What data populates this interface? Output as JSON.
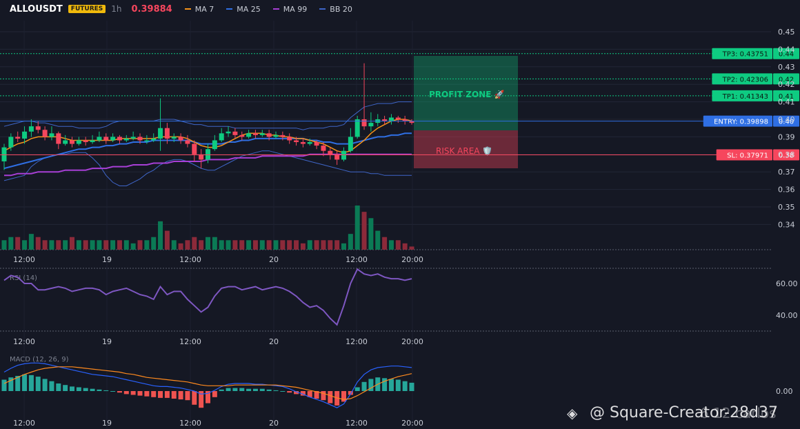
{
  "header": {
    "symbol": "ALLOUSDT",
    "badge": "FUTURES",
    "timeframe": "1h",
    "last_price": "0.39884",
    "legend": [
      {
        "label": "MA 7",
        "color": "#f7931a"
      },
      {
        "label": "MA 25",
        "color": "#2f6fe4"
      },
      {
        "label": "MA 99",
        "color": "#a83fd6"
      },
      {
        "label": "BB 20",
        "color": "#3f66c9"
      }
    ]
  },
  "colors": {
    "up": "#0ecb81",
    "down": "#f6465d",
    "background": "#151824"
  },
  "chart_data": {
    "type": "candlestick",
    "y_ticks": [
      "0.45",
      "0.44",
      "0.43",
      "0.42",
      "0.41",
      "0.40",
      "0.39",
      "0.38",
      "0.37",
      "0.36",
      "0.35",
      "0.34"
    ],
    "x_ticks": [
      "12:00",
      "19",
      "12:00",
      "20",
      "12:00",
      "20:00"
    ],
    "ylim": [
      0.335,
      0.452
    ],
    "candles": [
      [
        0.376,
        0.384,
        0.371,
        0.386
      ],
      [
        0.384,
        0.39,
        0.382,
        0.392
      ],
      [
        0.39,
        0.389,
        0.387,
        0.393
      ],
      [
        0.389,
        0.393,
        0.386,
        0.396
      ],
      [
        0.393,
        0.396,
        0.39,
        0.4
      ],
      [
        0.396,
        0.394,
        0.392,
        0.399
      ],
      [
        0.394,
        0.39,
        0.388,
        0.396
      ],
      [
        0.39,
        0.392,
        0.388,
        0.396
      ],
      [
        0.392,
        0.386,
        0.383,
        0.393
      ],
      [
        0.386,
        0.388,
        0.385,
        0.391
      ],
      [
        0.388,
        0.386,
        0.384,
        0.39
      ],
      [
        0.386,
        0.388,
        0.385,
        0.39
      ],
      [
        0.388,
        0.387,
        0.385,
        0.39
      ],
      [
        0.387,
        0.388,
        0.386,
        0.391
      ],
      [
        0.388,
        0.39,
        0.387,
        0.393
      ],
      [
        0.39,
        0.388,
        0.386,
        0.392
      ],
      [
        0.388,
        0.39,
        0.387,
        0.392
      ],
      [
        0.39,
        0.388,
        0.386,
        0.391
      ],
      [
        0.388,
        0.389,
        0.387,
        0.391
      ],
      [
        0.389,
        0.39,
        0.388,
        0.393
      ],
      [
        0.39,
        0.388,
        0.386,
        0.392
      ],
      [
        0.388,
        0.388,
        0.386,
        0.391
      ],
      [
        0.388,
        0.389,
        0.387,
        0.392
      ],
      [
        0.389,
        0.395,
        0.382,
        0.412
      ],
      [
        0.395,
        0.389,
        0.386,
        0.398
      ],
      [
        0.389,
        0.39,
        0.387,
        0.392
      ],
      [
        0.39,
        0.388,
        0.386,
        0.392
      ],
      [
        0.388,
        0.386,
        0.384,
        0.391
      ],
      [
        0.386,
        0.38,
        0.376,
        0.388
      ],
      [
        0.38,
        0.377,
        0.372,
        0.383
      ],
      [
        0.377,
        0.383,
        0.375,
        0.386
      ],
      [
        0.383,
        0.388,
        0.382,
        0.391
      ],
      [
        0.388,
        0.392,
        0.387,
        0.395
      ],
      [
        0.392,
        0.393,
        0.39,
        0.396
      ],
      [
        0.393,
        0.391,
        0.389,
        0.395
      ],
      [
        0.391,
        0.39,
        0.388,
        0.393
      ],
      [
        0.39,
        0.392,
        0.389,
        0.394
      ],
      [
        0.392,
        0.391,
        0.389,
        0.394
      ],
      [
        0.391,
        0.392,
        0.39,
        0.394
      ],
      [
        0.392,
        0.39,
        0.388,
        0.394
      ],
      [
        0.39,
        0.391,
        0.389,
        0.393
      ],
      [
        0.391,
        0.39,
        0.388,
        0.393
      ],
      [
        0.39,
        0.388,
        0.386,
        0.392
      ],
      [
        0.388,
        0.387,
        0.385,
        0.39
      ],
      [
        0.387,
        0.386,
        0.384,
        0.389
      ],
      [
        0.386,
        0.387,
        0.385,
        0.389
      ],
      [
        0.387,
        0.385,
        0.383,
        0.388
      ],
      [
        0.385,
        0.382,
        0.379,
        0.387
      ],
      [
        0.382,
        0.38,
        0.377,
        0.384
      ],
      [
        0.38,
        0.377,
        0.374,
        0.382
      ],
      [
        0.377,
        0.382,
        0.376,
        0.384
      ],
      [
        0.382,
        0.39,
        0.381,
        0.395
      ],
      [
        0.39,
        0.4,
        0.389,
        0.402
      ],
      [
        0.4,
        0.396,
        0.394,
        0.432
      ],
      [
        0.396,
        0.398,
        0.393,
        0.404
      ],
      [
        0.398,
        0.4,
        0.396,
        0.403
      ],
      [
        0.4,
        0.399,
        0.397,
        0.402
      ],
      [
        0.399,
        0.401,
        0.397,
        0.403
      ],
      [
        0.401,
        0.4,
        0.398,
        0.402
      ],
      [
        0.4,
        0.399,
        0.397,
        0.402
      ],
      [
        0.399,
        0.398,
        0.397,
        0.4
      ]
    ],
    "volume": [
      3,
      4,
      4,
      3,
      5,
      4,
      3,
      3,
      3,
      3,
      4,
      3,
      3,
      3,
      3,
      3,
      3,
      3,
      3,
      2,
      3,
      3,
      4,
      9,
      6,
      3,
      2,
      3,
      4,
      3,
      4,
      4,
      3,
      3,
      3,
      3,
      3,
      3,
      3,
      3,
      3,
      3,
      3,
      3,
      2,
      3,
      3,
      3,
      3,
      3,
      2,
      5,
      14,
      12,
      10,
      6,
      4,
      3,
      3,
      2,
      1
    ],
    "ma7": [
      0.382,
      0.384,
      0.386,
      0.387,
      0.389,
      0.39,
      0.39,
      0.39,
      0.39,
      0.389,
      0.388,
      0.388,
      0.388,
      0.388,
      0.388,
      0.388,
      0.388,
      0.389,
      0.389,
      0.389,
      0.389,
      0.389,
      0.389,
      0.39,
      0.39,
      0.39,
      0.39,
      0.389,
      0.387,
      0.385,
      0.384,
      0.384,
      0.385,
      0.387,
      0.389,
      0.391,
      0.392,
      0.392,
      0.392,
      0.391,
      0.391,
      0.39,
      0.39,
      0.389,
      0.389,
      0.388,
      0.387,
      0.386,
      0.384,
      0.382,
      0.381,
      0.382,
      0.385,
      0.388,
      0.392,
      0.395,
      0.397,
      0.399,
      0.4,
      0.4,
      0.399
    ],
    "ma25": [
      0.372,
      0.373,
      0.374,
      0.375,
      0.376,
      0.377,
      0.378,
      0.379,
      0.38,
      0.381,
      0.382,
      0.383,
      0.383,
      0.384,
      0.384,
      0.385,
      0.385,
      0.386,
      0.386,
      0.387,
      0.387,
      0.387,
      0.388,
      0.388,
      0.388,
      0.388,
      0.388,
      0.388,
      0.387,
      0.386,
      0.386,
      0.386,
      0.386,
      0.387,
      0.387,
      0.388,
      0.388,
      0.389,
      0.389,
      0.389,
      0.389,
      0.389,
      0.389,
      0.389,
      0.389,
      0.388,
      0.388,
      0.387,
      0.387,
      0.386,
      0.386,
      0.386,
      0.387,
      0.388,
      0.389,
      0.39,
      0.39,
      0.391,
      0.391,
      0.392,
      0.392
    ],
    "ma99": [
      0.368,
      0.368,
      0.369,
      0.369,
      0.369,
      0.37,
      0.37,
      0.37,
      0.37,
      0.371,
      0.371,
      0.371,
      0.371,
      0.372,
      0.372,
      0.372,
      0.373,
      0.373,
      0.373,
      0.374,
      0.374,
      0.374,
      0.375,
      0.375,
      0.375,
      0.376,
      0.376,
      0.376,
      0.376,
      0.376,
      0.377,
      0.377,
      0.377,
      0.377,
      0.378,
      0.378,
      0.378,
      0.378,
      0.379,
      0.379,
      0.379,
      0.379,
      0.379,
      0.379,
      0.379,
      0.38,
      0.38,
      0.38,
      0.38,
      0.38,
      0.38,
      0.38,
      0.38,
      0.38,
      0.38,
      0.38,
      0.38,
      0.38,
      0.38,
      0.38,
      0.38
    ],
    "bb_upper": [
      0.396,
      0.397,
      0.398,
      0.399,
      0.399,
      0.398,
      0.398,
      0.397,
      0.396,
      0.396,
      0.396,
      0.395,
      0.395,
      0.395,
      0.395,
      0.396,
      0.398,
      0.399,
      0.399,
      0.399,
      0.399,
      0.399,
      0.399,
      0.4,
      0.4,
      0.4,
      0.399,
      0.398,
      0.397,
      0.397,
      0.396,
      0.396,
      0.396,
      0.396,
      0.395,
      0.395,
      0.395,
      0.395,
      0.395,
      0.395,
      0.395,
      0.395,
      0.395,
      0.395,
      0.394,
      0.395,
      0.395,
      0.395,
      0.396,
      0.396,
      0.397,
      0.401,
      0.404,
      0.407,
      0.408,
      0.409,
      0.409,
      0.409,
      0.41,
      0.41,
      0.41
    ],
    "bb_lower": [
      0.365,
      0.366,
      0.367,
      0.368,
      0.373,
      0.376,
      0.378,
      0.379,
      0.38,
      0.38,
      0.381,
      0.381,
      0.381,
      0.378,
      0.374,
      0.368,
      0.364,
      0.362,
      0.362,
      0.364,
      0.366,
      0.369,
      0.371,
      0.374,
      0.376,
      0.377,
      0.377,
      0.376,
      0.374,
      0.372,
      0.371,
      0.371,
      0.373,
      0.375,
      0.377,
      0.379,
      0.38,
      0.381,
      0.382,
      0.382,
      0.381,
      0.38,
      0.379,
      0.378,
      0.377,
      0.376,
      0.375,
      0.374,
      0.373,
      0.372,
      0.371,
      0.37,
      0.37,
      0.37,
      0.369,
      0.369,
      0.368,
      0.368,
      0.368,
      0.368,
      0.368
    ],
    "levels": [
      {
        "label": "TP3: 0.43751",
        "price": 0.43751,
        "tick": "0.44",
        "color": "#0ecb81"
      },
      {
        "label": "TP2: 0.42306",
        "price": 0.42306,
        "tick": "0.42",
        "color": "#0ecb81"
      },
      {
        "label": "TP1: 0.41343",
        "price": 0.41343,
        "tick": "0.41",
        "color": "#0ecb81"
      },
      {
        "label": "ENTRY: 0.39898",
        "price": 0.39898,
        "tick": "0.40",
        "color": "#2f6fe4"
      },
      {
        "label": "SL: 0.37971",
        "price": 0.37971,
        "tick": "0.38",
        "color": "#f6465d"
      }
    ],
    "zones": {
      "profit_label": "PROFIT ZONE 🚀",
      "risk_label": "RISK AREA 🛡️"
    },
    "rsi": {
      "label": "RSI (14)",
      "y_ticks": [
        "60.00",
        "40.00"
      ],
      "ylim": [
        30,
        70
      ],
      "values": [
        62,
        65,
        64,
        60,
        60,
        56,
        56,
        57,
        58,
        57,
        55,
        56,
        57,
        57,
        56,
        53,
        55,
        56,
        57,
        55,
        53,
        52,
        50,
        58,
        53,
        55,
        55,
        50,
        46,
        42,
        45,
        52,
        57,
        58,
        58,
        56,
        57,
        58,
        56,
        57,
        58,
        57,
        55,
        52,
        48,
        45,
        46,
        43,
        38,
        34,
        46,
        60,
        69,
        66,
        65,
        66,
        64,
        63,
        63,
        62,
        63
      ]
    },
    "macd": {
      "label": "MACD (12, 26, 9)",
      "y_tick": "0.00",
      "ylim": [
        -0.006,
        0.008
      ],
      "histogram": [
        0.0015,
        0.0018,
        0.002,
        0.0022,
        0.0021,
        0.0019,
        0.0016,
        0.0013,
        0.001,
        0.0008,
        0.0006,
        0.0005,
        0.0004,
        0.0003,
        0.0002,
        0.0001,
        0.0,
        -0.0002,
        -0.0004,
        -0.0005,
        -0.0006,
        -0.0007,
        -0.0008,
        -0.0009,
        -0.0009,
        -0.001,
        -0.0011,
        -0.0012,
        -0.0018,
        -0.0022,
        -0.0016,
        -0.0008,
        0.0002,
        0.0004,
        0.0004,
        0.0004,
        0.0003,
        0.0003,
        0.0003,
        0.0002,
        0.0001,
        0.0,
        -0.0002,
        -0.0004,
        -0.0006,
        -0.0008,
        -0.001,
        -0.0012,
        -0.0016,
        -0.0019,
        -0.0014,
        -0.0005,
        0.0005,
        0.0012,
        0.0016,
        0.0018,
        0.0017,
        0.0016,
        0.0015,
        0.0013,
        0.0011
      ],
      "macd_line": [
        0.0025,
        0.003,
        0.0034,
        0.0036,
        0.0037,
        0.0037,
        0.0036,
        0.0034,
        0.0032,
        0.003,
        0.0028,
        0.0026,
        0.0024,
        0.0022,
        0.0021,
        0.002,
        0.0019,
        0.0017,
        0.0015,
        0.0013,
        0.0011,
        0.0009,
        0.0007,
        0.0006,
        0.0006,
        0.0005,
        0.0004,
        0.0002,
        0.0,
        -0.0004,
        -0.0003,
        0.0001,
        0.0006,
        0.0009,
        0.001,
        0.001,
        0.001,
        0.0009,
        0.0009,
        0.0008,
        0.0007,
        0.0006,
        0.0003,
        -0.0001,
        -0.0004,
        -0.0008,
        -0.0011,
        -0.0014,
        -0.0018,
        -0.0022,
        -0.0017,
        -0.0004,
        0.0012,
        0.0022,
        0.0028,
        0.0031,
        0.0032,
        0.0033,
        0.0033,
        0.0032,
        0.0031
      ],
      "signal_line": [
        0.001,
        0.0014,
        0.0018,
        0.0022,
        0.0025,
        0.0028,
        0.003,
        0.0031,
        0.0032,
        0.0032,
        0.0032,
        0.0031,
        0.003,
        0.0029,
        0.0028,
        0.0027,
        0.0026,
        0.0025,
        0.0023,
        0.0022,
        0.002,
        0.0018,
        0.0017,
        0.0016,
        0.0015,
        0.0014,
        0.0013,
        0.0012,
        0.001,
        0.0008,
        0.0007,
        0.0007,
        0.0007,
        0.0007,
        0.0008,
        0.0008,
        0.0008,
        0.0008,
        0.0008,
        0.0008,
        0.0008,
        0.0007,
        0.0006,
        0.0005,
        0.0003,
        0.0001,
        -0.0001,
        -0.0003,
        -0.0006,
        -0.0009,
        -0.0011,
        -0.001,
        -0.0006,
        -0.0001,
        0.0004,
        0.0009,
        0.0013,
        0.0016,
        0.0019,
        0.0021,
        0.0023
      ]
    }
  },
  "watermark": {
    "text": "@ Square-Creator-28d37",
    "text2": "6 12 carlos"
  }
}
